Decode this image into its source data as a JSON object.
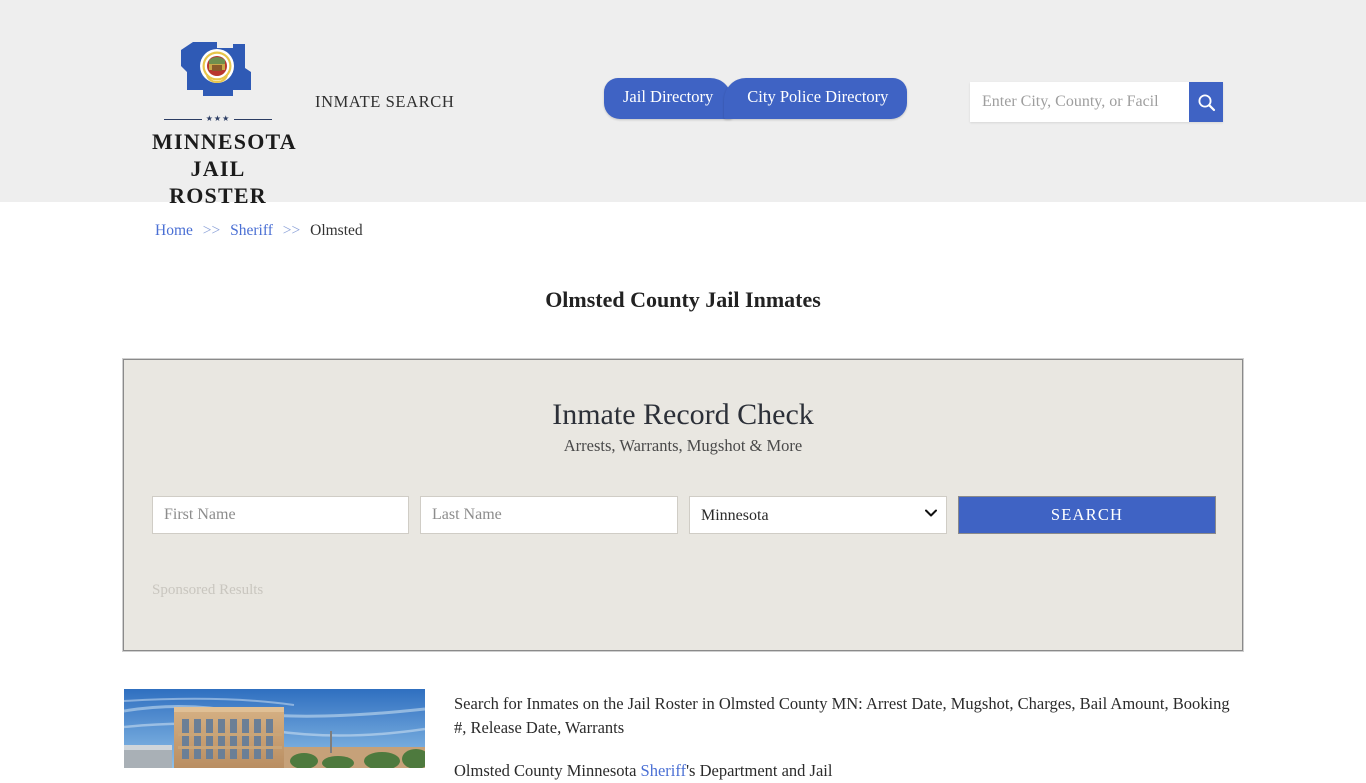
{
  "header": {
    "logo": {
      "line1": "MINNESOTA",
      "line2": "JAIL ROSTER",
      "rule_text": "★★★",
      "icon": "minnesota-state-seal-icon"
    },
    "tagline": "INMATE SEARCH",
    "nav": [
      {
        "label": "Jail Directory"
      },
      {
        "label": "City Police Directory"
      }
    ],
    "search": {
      "placeholder": "Enter City, County, or Facil",
      "value": "",
      "button_icon": "search-icon"
    },
    "background_color": "#eeeeee",
    "accent_color": "#3f63c4"
  },
  "breadcrumb": {
    "items": [
      {
        "label": "Home",
        "link": true
      },
      {
        "label": "Sheriff",
        "link": true
      },
      {
        "label": "Olmsted",
        "link": false
      }
    ],
    "separator": ">>"
  },
  "page_title": "Olmsted County Jail Inmates",
  "record_check": {
    "title": "Inmate Record Check",
    "subtitle": "Arrests, Warrants, Mugshot & More",
    "first_name_placeholder": "First Name",
    "first_name_value": "",
    "last_name_placeholder": "Last Name",
    "last_name_value": "",
    "state_selected": "Minnesota",
    "state_options": [
      "Minnesota"
    ],
    "search_button": "SEARCH",
    "sponsored_label": "Sponsored Results",
    "card_background": "#e9e7e1",
    "button_color": "#3f63c4"
  },
  "content": {
    "thumbnail_alt": "olmsted-county-courthouse-photo",
    "paragraph1": "Search for Inmates on the Jail Roster in Olmsted County MN: Arrest Date, Mugshot, Charges, Bail Amount, Booking #, Release Date, Warrants",
    "paragraph2_pre": "Olmsted County Minnesota ",
    "paragraph2_link": "Sheriff",
    "paragraph2_post": "'s Department and Jail"
  }
}
